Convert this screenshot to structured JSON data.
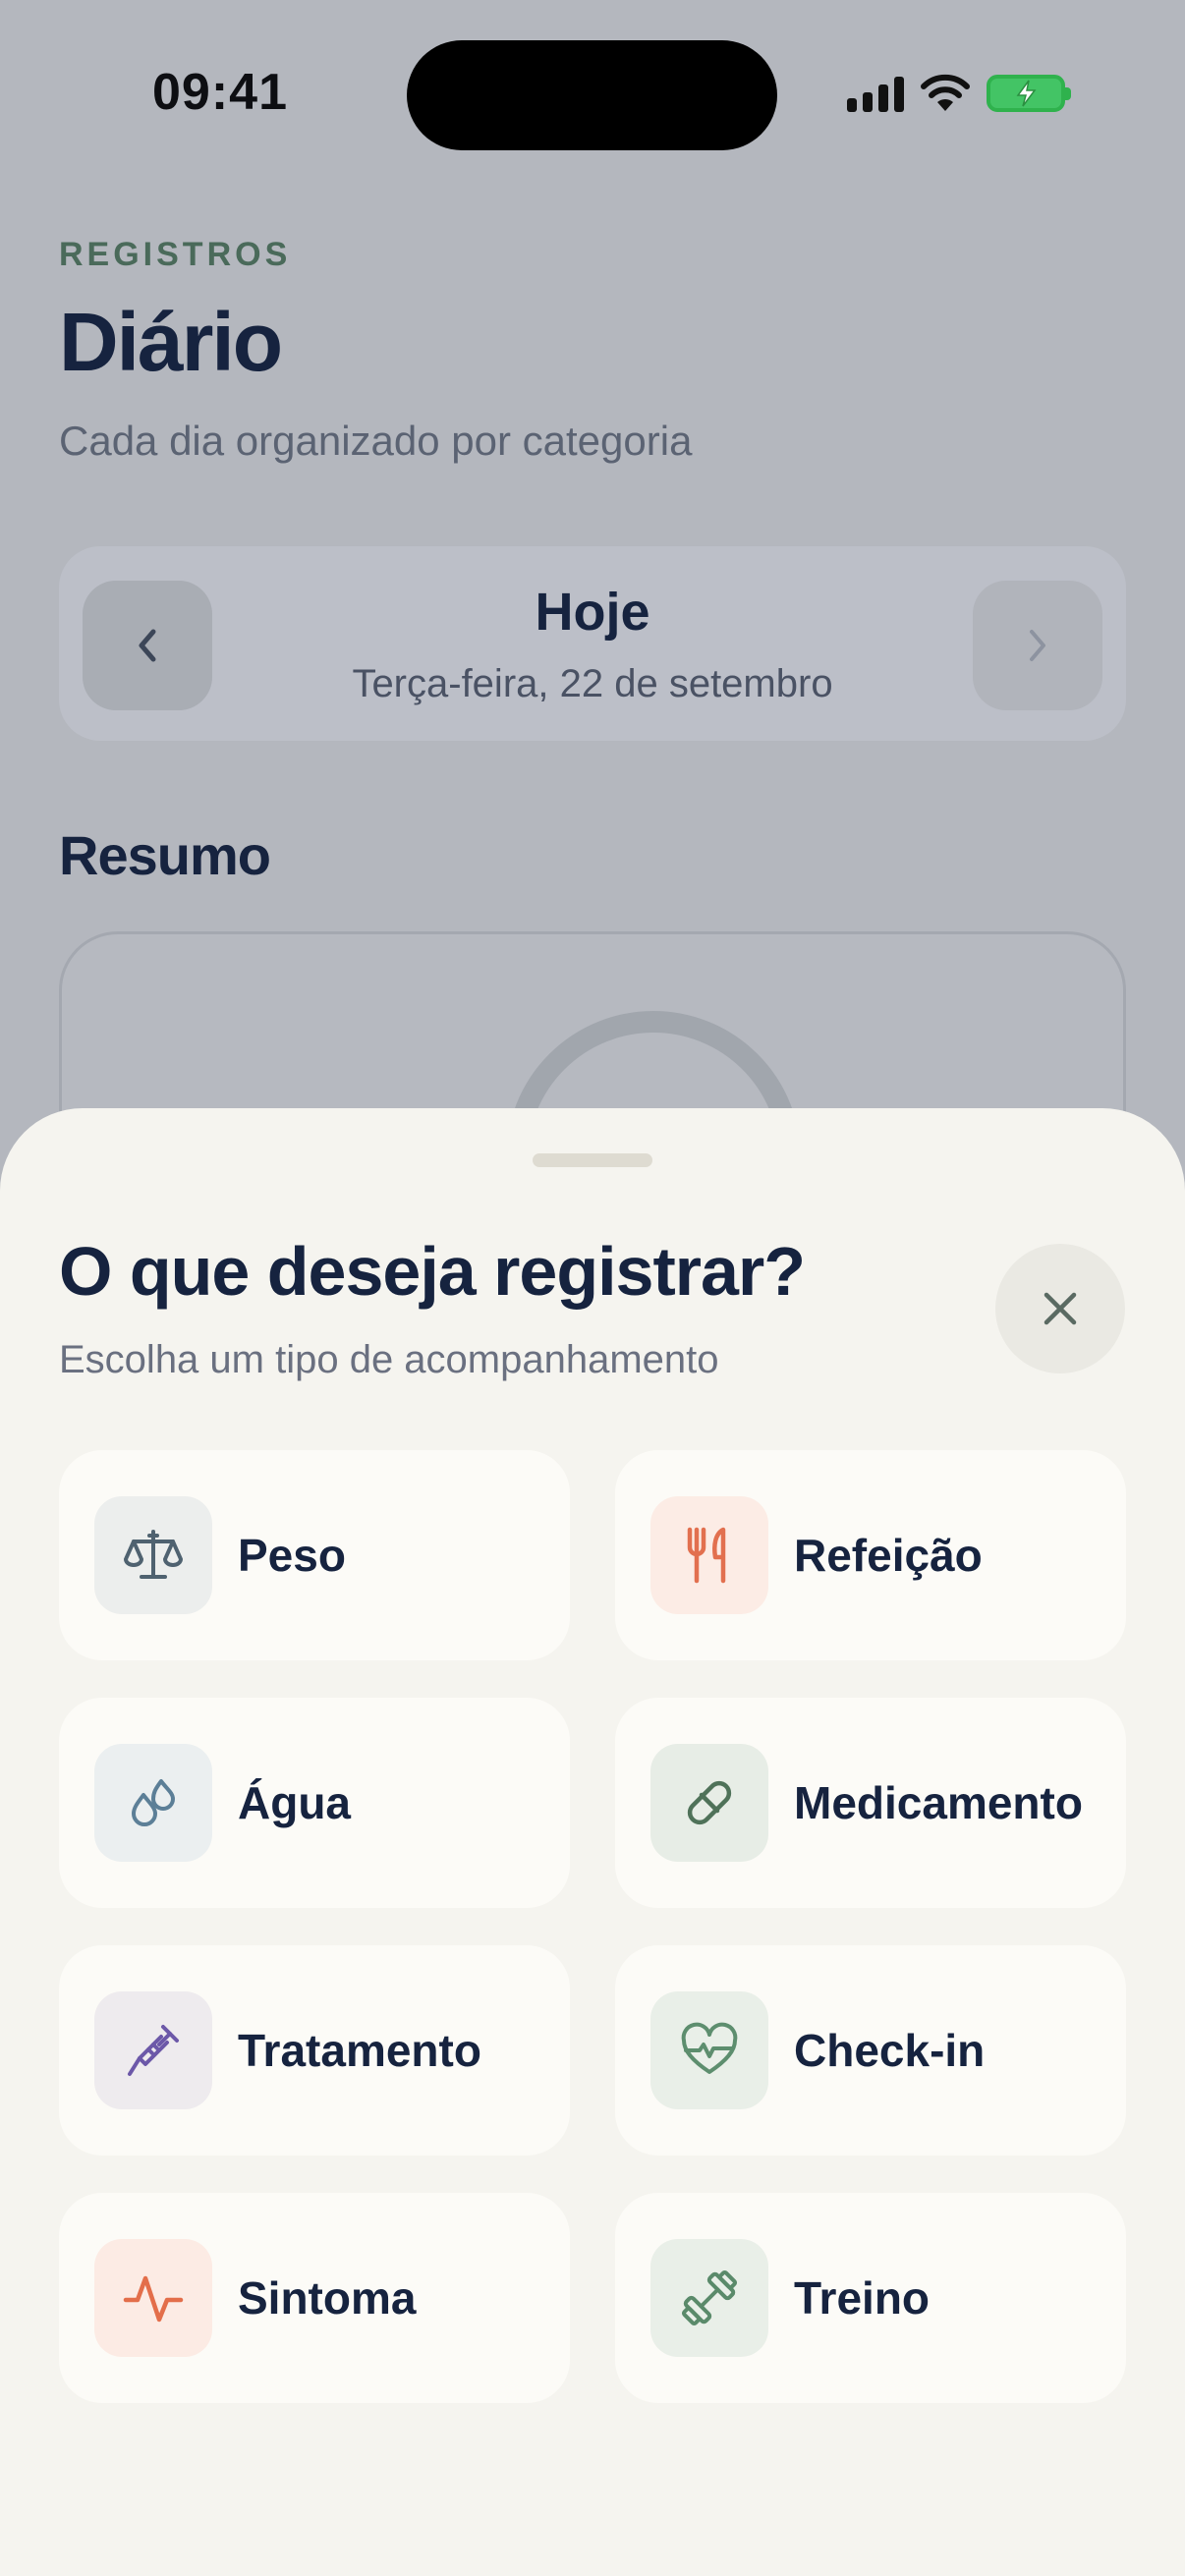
{
  "status_bar": {
    "time": "09:41"
  },
  "header": {
    "eyebrow": "REGISTROS",
    "title": "Diário",
    "subtitle": "Cada dia organizado por categoria"
  },
  "date_nav": {
    "label": "Hoje",
    "date": "Terça-feira, 22 de setembro"
  },
  "summary": {
    "title": "Resumo"
  },
  "sheet": {
    "title": "O que deseja registrar?",
    "subtitle": "Escolha um tipo de acompanhamento",
    "options": [
      {
        "label": "Peso",
        "icon": "scale-icon",
        "color": "#4f6270",
        "bg": "#eceeed"
      },
      {
        "label": "Refeição",
        "icon": "utensils-icon",
        "color": "#e2704f",
        "bg": "#fcece5"
      },
      {
        "label": "Água",
        "icon": "droplets-icon",
        "color": "#5c7f97",
        "bg": "#ebeff0"
      },
      {
        "label": "Medicamento",
        "icon": "pill-icon",
        "color": "#4f7259",
        "bg": "#e7ede6"
      },
      {
        "label": "Tratamento",
        "icon": "syringe-icon",
        "color": "#6c58a8",
        "bg": "#eeebee"
      },
      {
        "label": "Check-in",
        "icon": "heart-pulse-icon",
        "color": "#5d8e6e",
        "bg": "#e9efe8"
      },
      {
        "label": "Sintoma",
        "icon": "activity-icon",
        "color": "#e36e4a",
        "bg": "#fcebe4"
      },
      {
        "label": "Treino",
        "icon": "dumbbell-icon",
        "color": "#5a8a6a",
        "bg": "#e9efe8"
      }
    ]
  },
  "colors": {
    "primary_text": "#16233f",
    "accent_green": "#4a6a5a",
    "sheet_bg": "#f5f4ef",
    "card_bg": "#fcfbf7"
  }
}
